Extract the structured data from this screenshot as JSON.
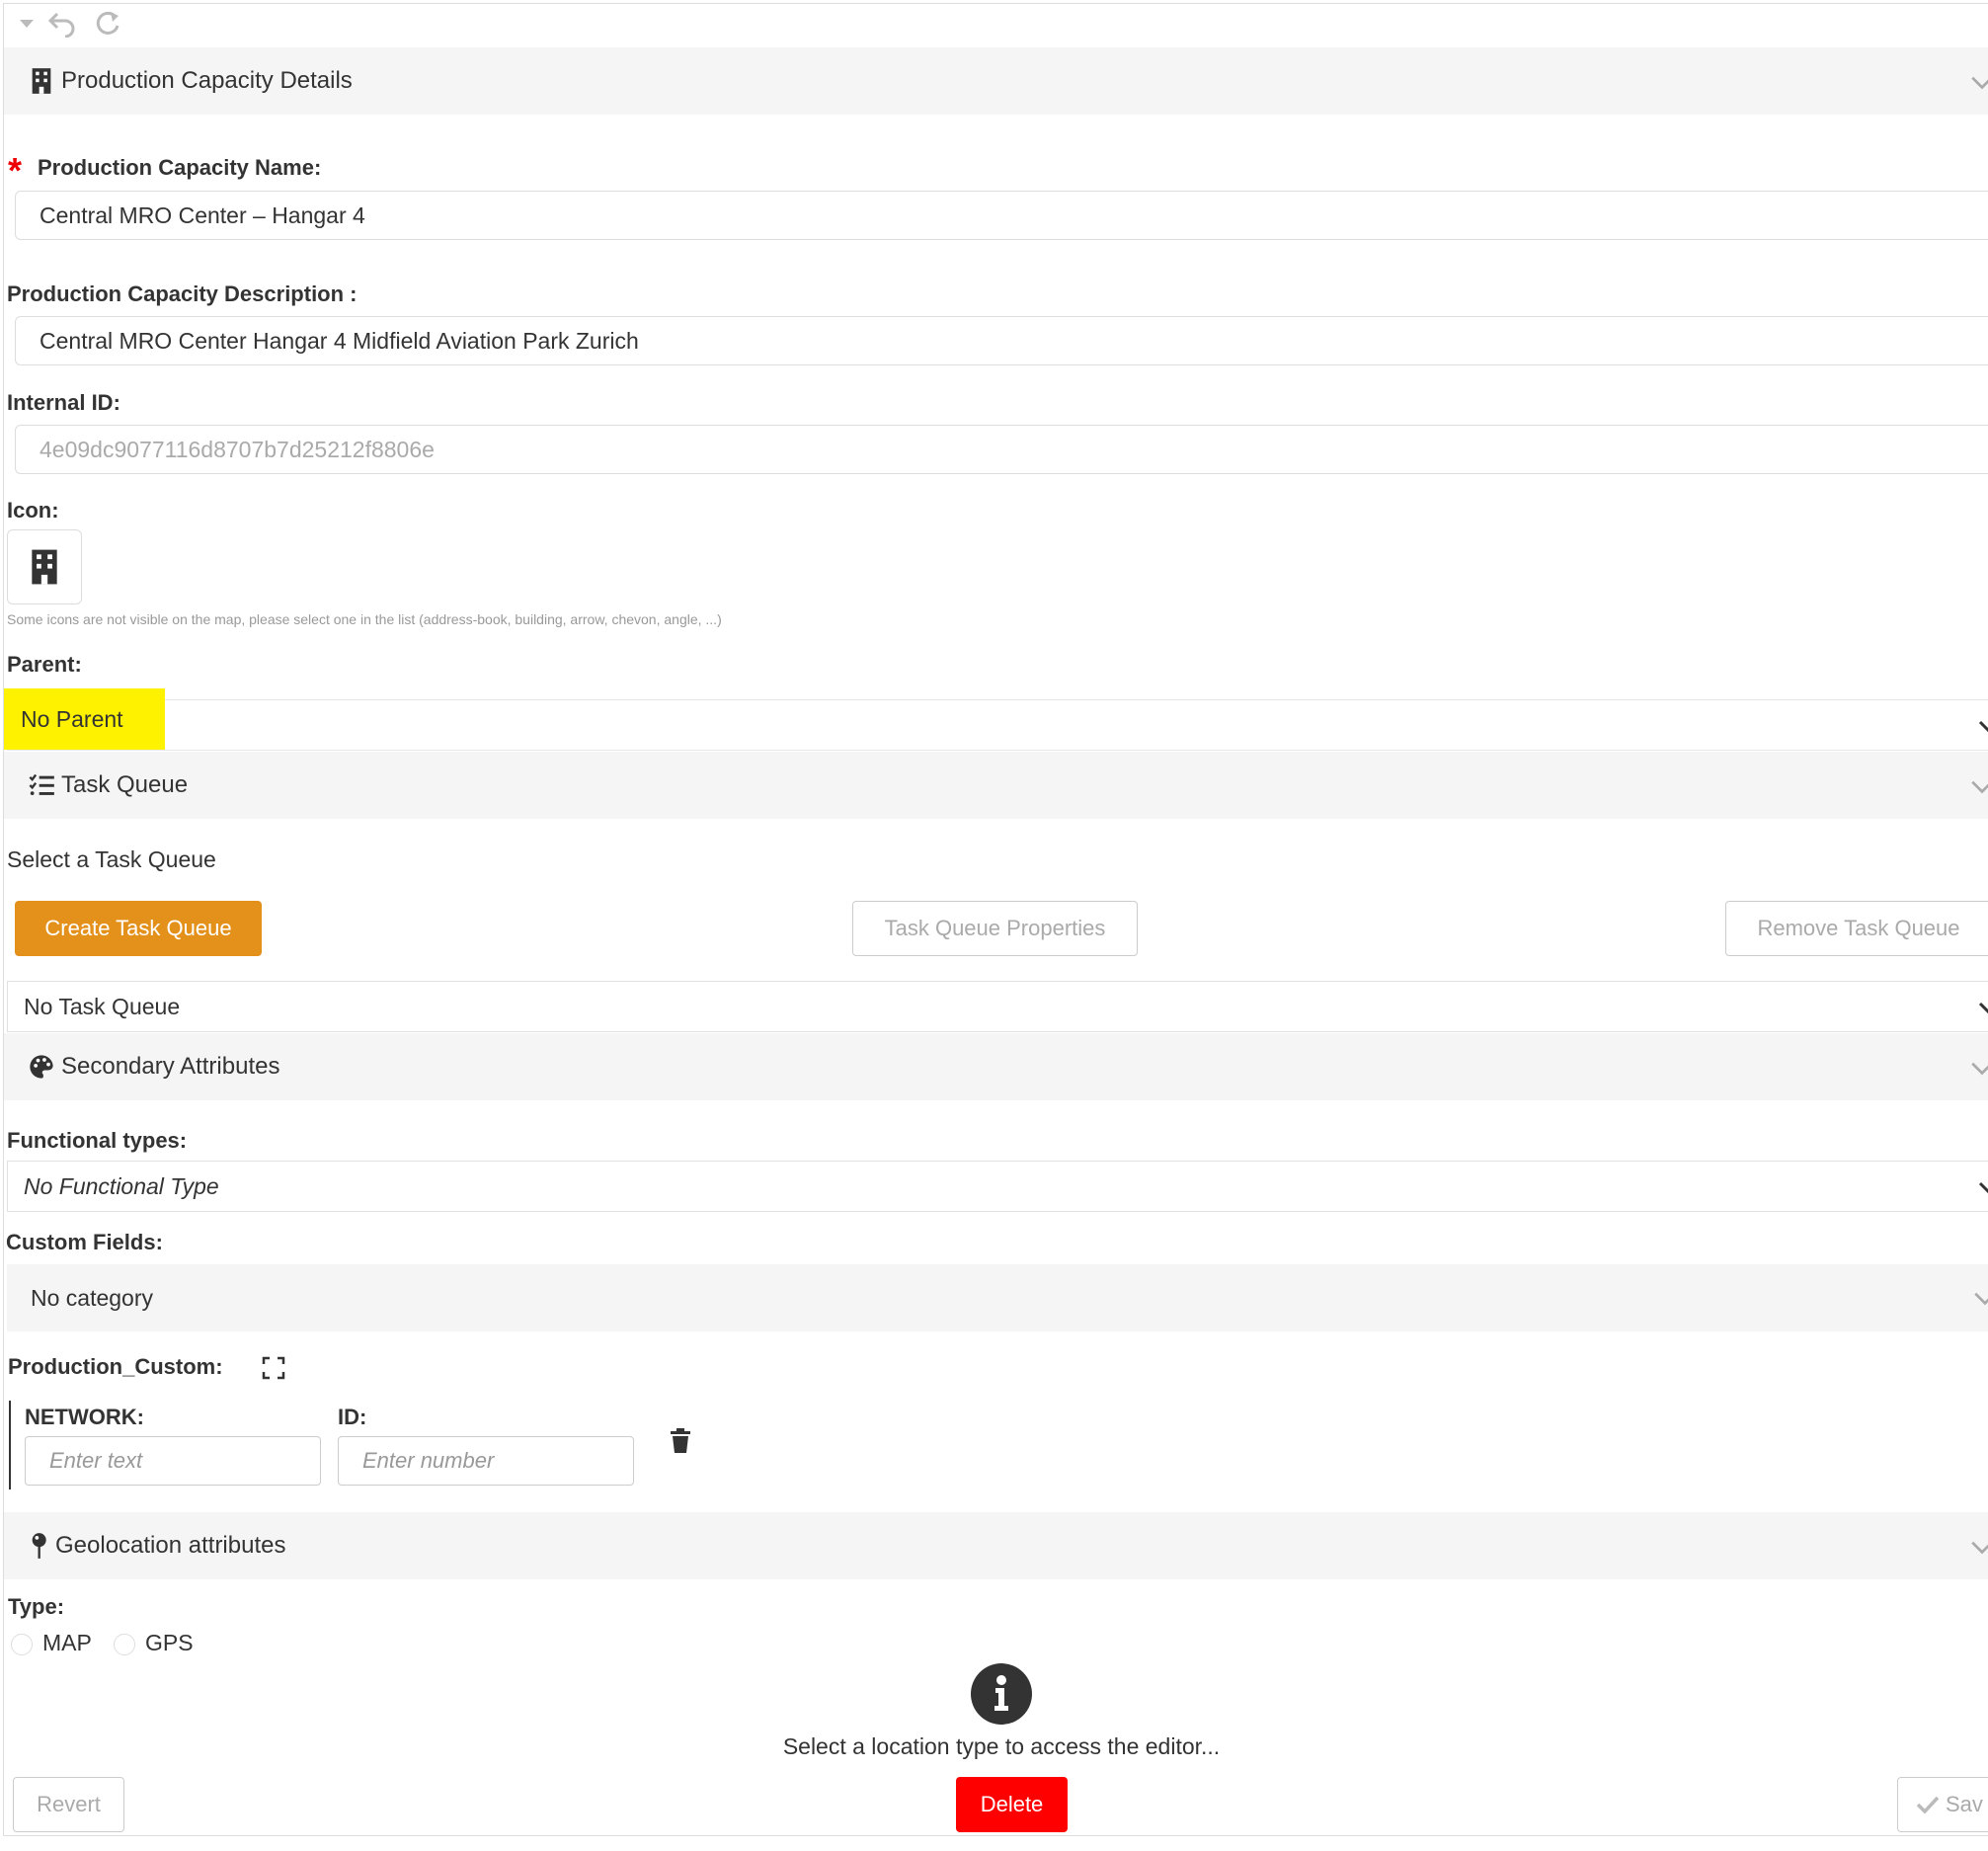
{
  "toolbar": {
    "collapse_icon": "caret-down-icon",
    "undo_icon": "undo-icon",
    "redo_icon": "redo-icon"
  },
  "sections": {
    "details": {
      "title": "Production Capacity Details",
      "icon": "building-icon"
    },
    "task_queue": {
      "title": "Task Queue",
      "icon": "task-list-icon"
    },
    "secondary": {
      "title": "Secondary Attributes",
      "icon": "palette-icon"
    },
    "geolocation": {
      "title": "Geolocation attributes",
      "icon": "map-pin-icon"
    }
  },
  "fields": {
    "name": {
      "required_mark": "*",
      "label": "Production Capacity Name:",
      "value": "Central MRO Center – Hangar 4"
    },
    "description": {
      "label": "Production Capacity Description :",
      "value": "Central MRO Center Hangar 4 Midfield Aviation Park Zurich"
    },
    "internal_id": {
      "label": "Internal ID:",
      "value": "4e09dc9077116d8707b7d25212f8806e"
    },
    "icon": {
      "label": "Icon:",
      "selected": "building-icon",
      "hint": "Some icons are not visible on the map, please select one in the list (address-book, building, arrow, chevon, angle, ...)"
    },
    "parent": {
      "label": "Parent:",
      "value": "No Parent",
      "highlight_color": "#fff200"
    }
  },
  "task_queue": {
    "prompt": "Select a Task Queue",
    "create_label": "Create Task Queue",
    "properties_label": "Task Queue Properties",
    "remove_label": "Remove Task Queue",
    "selected": "No Task Queue",
    "accent_color": "#e4911c"
  },
  "secondary": {
    "functional_label": "Functional types:",
    "functional_value": "No Functional Type",
    "custom_fields_label": "Custom Fields:",
    "category": "No category",
    "group_label": "Production_Custom:",
    "network_label": "NETWORK:",
    "network_placeholder": "Enter text",
    "id_label": "ID:",
    "id_placeholder": "Enter number"
  },
  "geolocation": {
    "type_label": "Type:",
    "option_map": "MAP",
    "option_gps": "GPS",
    "info_message": "Select a location type to access the editor..."
  },
  "footer": {
    "revert_label": "Revert",
    "delete_label": "Delete",
    "save_label": "Sav",
    "delete_color": "#ff0000"
  }
}
